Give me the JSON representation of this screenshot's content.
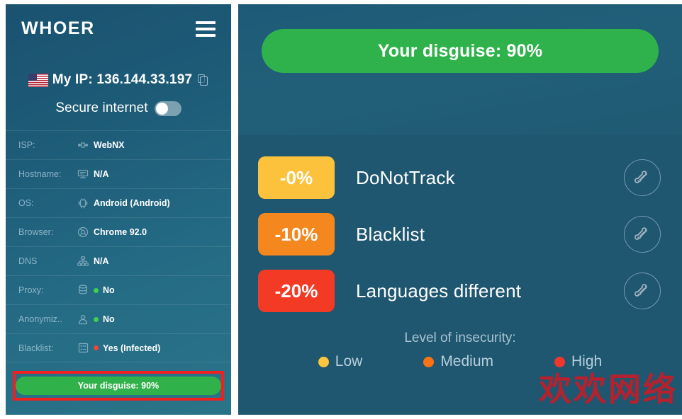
{
  "sidebar": {
    "brand": "WHOER",
    "menu_icon": "hamburger-icon",
    "ip": {
      "flag": "us-flag-icon",
      "label": "My IP: 136.144.33.197",
      "copy_icon": "copy-icon"
    },
    "secure_internet": {
      "label": "Secure internet",
      "state": "off"
    },
    "rows": [
      {
        "label": "ISP:",
        "icon": "network-icon",
        "value": "WebNX",
        "dot": null
      },
      {
        "label": "Hostname:",
        "icon": "monitor-icon",
        "value": "N/A",
        "dot": null
      },
      {
        "label": "OS:",
        "icon": "android-icon",
        "value": "Android (Android)",
        "dot": null
      },
      {
        "label": "Browser:",
        "icon": "chrome-icon",
        "value": "Chrome 92.0",
        "dot": null
      },
      {
        "label": "DNS",
        "icon": "dns-tree-icon",
        "value": "N/A",
        "dot": null
      },
      {
        "label": "Proxy:",
        "icon": "database-icon",
        "value": "No",
        "dot": "#3ed14f"
      },
      {
        "label": "Anonymiz..",
        "icon": "user-icon",
        "value": "No",
        "dot": "#3ed14f"
      },
      {
        "label": "Blacklist:",
        "icon": "list-icon",
        "value": "Yes (Infected)",
        "dot": "#f0453a"
      }
    ],
    "disguise_button": "Your disguise: 90%"
  },
  "main": {
    "disguise_button": "Your disguise: 90%",
    "issues": [
      {
        "percent": "-0%",
        "label": "DoNotTrack",
        "color": "#fcc23c",
        "action_icon": "wrench-icon"
      },
      {
        "percent": "-10%",
        "label": "Blacklist",
        "color": "#f5871f",
        "action_icon": "wrench-icon"
      },
      {
        "percent": "-20%",
        "label": "Languages different",
        "color": "#f23a25",
        "action_icon": "wrench-icon"
      }
    ],
    "legend": {
      "title": "Level of insecurity:",
      "items": [
        {
          "label": "Low",
          "color": "#fdc63c"
        },
        {
          "label": "Medium",
          "color": "#f97316"
        },
        {
          "label": "High",
          "color": "#f0372b"
        }
      ]
    },
    "watermark": "欢欢网络"
  },
  "annotation": {
    "highlight_color": "#f21f1f"
  }
}
